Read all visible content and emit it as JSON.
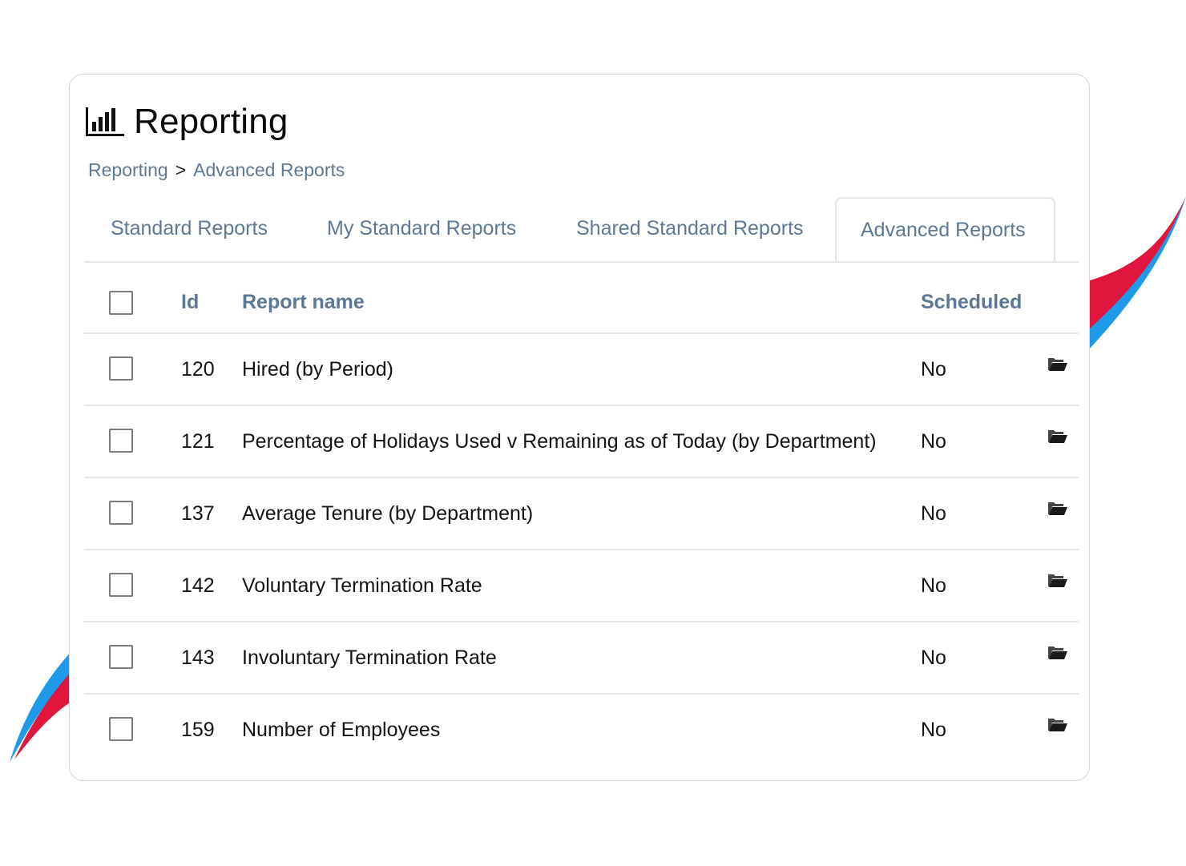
{
  "header": {
    "icon": "bar-chart-icon",
    "title": "Reporting"
  },
  "breadcrumb": {
    "items": [
      "Reporting",
      "Advanced Reports"
    ],
    "separator": ">"
  },
  "tabs": [
    {
      "label": "Standard Reports",
      "active": false
    },
    {
      "label": "My Standard Reports",
      "active": false
    },
    {
      "label": "Shared Standard Reports",
      "active": false
    },
    {
      "label": "Advanced Reports",
      "active": true
    }
  ],
  "table": {
    "columns": {
      "select": "",
      "id": "Id",
      "name": "Report name",
      "scheduled": "Scheduled",
      "action": ""
    },
    "row_action_icon": "folder-open-icon",
    "rows": [
      {
        "id": "120",
        "name": "Hired (by Period)",
        "scheduled": "No",
        "checked": false
      },
      {
        "id": "121",
        "name": "Percentage of Holidays Used v Remaining as of Today (by Department)",
        "scheduled": "No",
        "checked": false
      },
      {
        "id": "137",
        "name": "Average Tenure (by Department)",
        "scheduled": "No",
        "checked": false
      },
      {
        "id": "142",
        "name": "Voluntary Termination Rate",
        "scheduled": "No",
        "checked": false
      },
      {
        "id": "143",
        "name": "Involuntary Termination Rate",
        "scheduled": "No",
        "checked": false
      },
      {
        "id": "159",
        "name": "Number of Employees",
        "scheduled": "No",
        "checked": false
      }
    ]
  },
  "colors": {
    "accent_text": "#5d7896",
    "swoosh_red": "#e0163f",
    "swoosh_blue": "#1e9be8"
  }
}
